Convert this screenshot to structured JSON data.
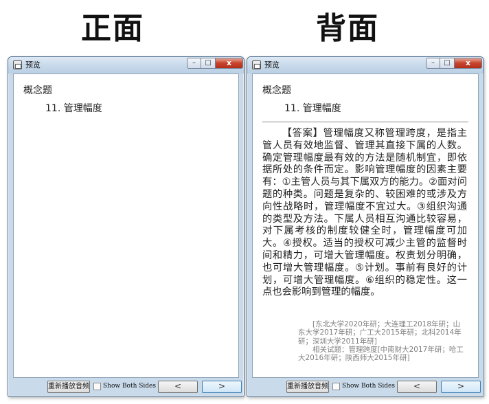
{
  "headings": {
    "front": "正面",
    "back": "背面"
  },
  "front_window": {
    "title": "预览",
    "section": "概念题",
    "question": "11. 管理幅度",
    "buttons": {
      "replay": "重新播放音频",
      "show_both_sides": "Show Both Sides",
      "prev": "<",
      "next": ">"
    }
  },
  "back_window": {
    "title": "预览",
    "section": "概念题",
    "question": "11. 管理幅度",
    "answer": "【答案】管理幅度又称管理跨度，是指主管人员有效地监督、管理其直接下属的人数。确定管理幅度最有效的方法是随机制宜，即依据所处的条件而定。影响管理幅度的因素主要有：①主管人员与其下属双方的能力。②面对问题的种类。问题是复杂的、较困难的或涉及方向性战略时，管理幅度不宜过大。③组织沟通的类型及方法。下属人员相互沟通比较容易，对下属考核的制度较健全时，管理幅度可加大。④授权。适当的授权可减少主管的监督时间和精力，可增大管理幅度。权责划分明确，也可增大管理幅度。⑤计划。事前有良好的计划，可增大管理幅度。⑥组织的稳定性。这一点也会影响到管理的幅度。",
    "source": "[东北大学2020年研；大连理工2018年研；山东大学2017年研；广工大2015年研；北科2014年研；深圳大学2011年研]",
    "related": "相关试题：管理跨度[中南财大2017年研；哈工大2016年研；陕西师大2015年研]",
    "buttons": {
      "replay": "重新播放音频",
      "show_both_sides": "Show Both Sides",
      "prev": "<",
      "next": ">"
    }
  },
  "window_controls": {
    "minimize": "–",
    "maximize": "□",
    "close": "x"
  }
}
